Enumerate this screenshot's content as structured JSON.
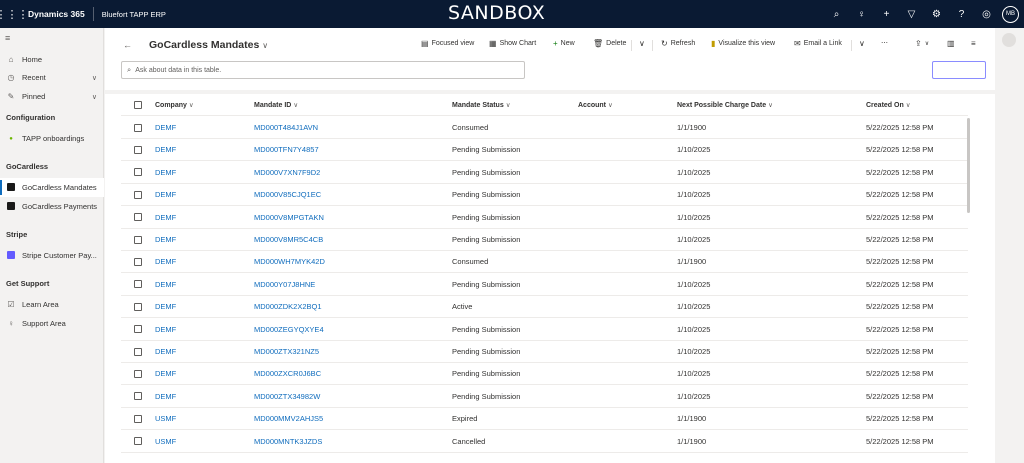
{
  "topbar": {
    "brand": "Dynamics 365",
    "app_name": "Bluefort TAPP ERP",
    "environment_banner": "SANDBOX",
    "user_initials": "MB",
    "icons": [
      "search-icon",
      "lightbulb-icon",
      "plus-icon",
      "filter-icon",
      "gear-icon",
      "help-icon",
      "copilot-icon"
    ]
  },
  "sidebar": {
    "home": "Home",
    "recent": "Recent",
    "pinned": "Pinned",
    "sections": [
      {
        "title": "Configuration",
        "items": [
          "TAPP onboardings"
        ]
      },
      {
        "title": "GoCardless",
        "items": [
          "GoCardless Mandates",
          "GoCardless Payments"
        ]
      },
      {
        "title": "Stripe",
        "items": [
          "Stripe Customer Pay..."
        ]
      },
      {
        "title": "Get Support",
        "items": [
          "Learn Area",
          "Support Area"
        ]
      }
    ],
    "selected": "GoCardless Mandates"
  },
  "page": {
    "title": "GoCardless Mandates",
    "ask_placeholder": "Ask about data in this table."
  },
  "commands": {
    "focused_view": "Focused view",
    "show_chart": "Show Chart",
    "new": "New",
    "delete": "Delete",
    "refresh": "Refresh",
    "visualize": "Visualize this view",
    "email_link": "Email a Link",
    "more": "⋯"
  },
  "grid": {
    "columns": [
      "Company",
      "Mandate ID",
      "Mandate Status",
      "Account",
      "Next Possible Charge Date",
      "Created On"
    ],
    "rows": [
      [
        "DEMF",
        "MD000T484J1AVN",
        "Consumed",
        "",
        "1/1/1900",
        "5/22/2025 12:58 PM"
      ],
      [
        "DEMF",
        "MD000TFN7Y4857",
        "Pending Submission",
        "",
        "1/10/2025",
        "5/22/2025 12:58 PM"
      ],
      [
        "DEMF",
        "MD000V7XN7F9D2",
        "Pending Submission",
        "",
        "1/10/2025",
        "5/22/2025 12:58 PM"
      ],
      [
        "DEMF",
        "MD000V85CJQ1EC",
        "Pending Submission",
        "",
        "1/10/2025",
        "5/22/2025 12:58 PM"
      ],
      [
        "DEMF",
        "MD000V8MPGTAKN",
        "Pending Submission",
        "",
        "1/10/2025",
        "5/22/2025 12:58 PM"
      ],
      [
        "DEMF",
        "MD000V8MR5C4CB",
        "Pending Submission",
        "",
        "1/10/2025",
        "5/22/2025 12:58 PM"
      ],
      [
        "DEMF",
        "MD000WH7MYK42D",
        "Consumed",
        "",
        "1/1/1900",
        "5/22/2025 12:58 PM"
      ],
      [
        "DEMF",
        "MD000Y07J8HNE",
        "Pending Submission",
        "",
        "1/10/2025",
        "5/22/2025 12:58 PM"
      ],
      [
        "DEMF",
        "MD000ZDK2X2BQ1",
        "Active",
        "",
        "1/10/2025",
        "5/22/2025 12:58 PM"
      ],
      [
        "DEMF",
        "MD000ZEGYQXYE4",
        "Pending Submission",
        "",
        "1/10/2025",
        "5/22/2025 12:58 PM"
      ],
      [
        "DEMF",
        "MD000ZTX321NZ5",
        "Pending Submission",
        "",
        "1/10/2025",
        "5/22/2025 12:58 PM"
      ],
      [
        "DEMF",
        "MD000ZXCR0J6BC",
        "Pending Submission",
        "",
        "1/10/2025",
        "5/22/2025 12:58 PM"
      ],
      [
        "DEMF",
        "MD000ZTX34982W",
        "Pending Submission",
        "",
        "1/10/2025",
        "5/22/2025 12:58 PM"
      ],
      [
        "USMF",
        "MD000MMV2AHJS5",
        "Expired",
        "",
        "1/1/1900",
        "5/22/2025 12:58 PM"
      ],
      [
        "USMF",
        "MD000MNTK3JZDS",
        "Cancelled",
        "",
        "1/1/1900",
        "5/22/2025 12:58 PM"
      ]
    ]
  },
  "colors": {
    "topbar": "#0a1a33",
    "link": "#0f6cbd",
    "accent": "#0f6cbd"
  }
}
